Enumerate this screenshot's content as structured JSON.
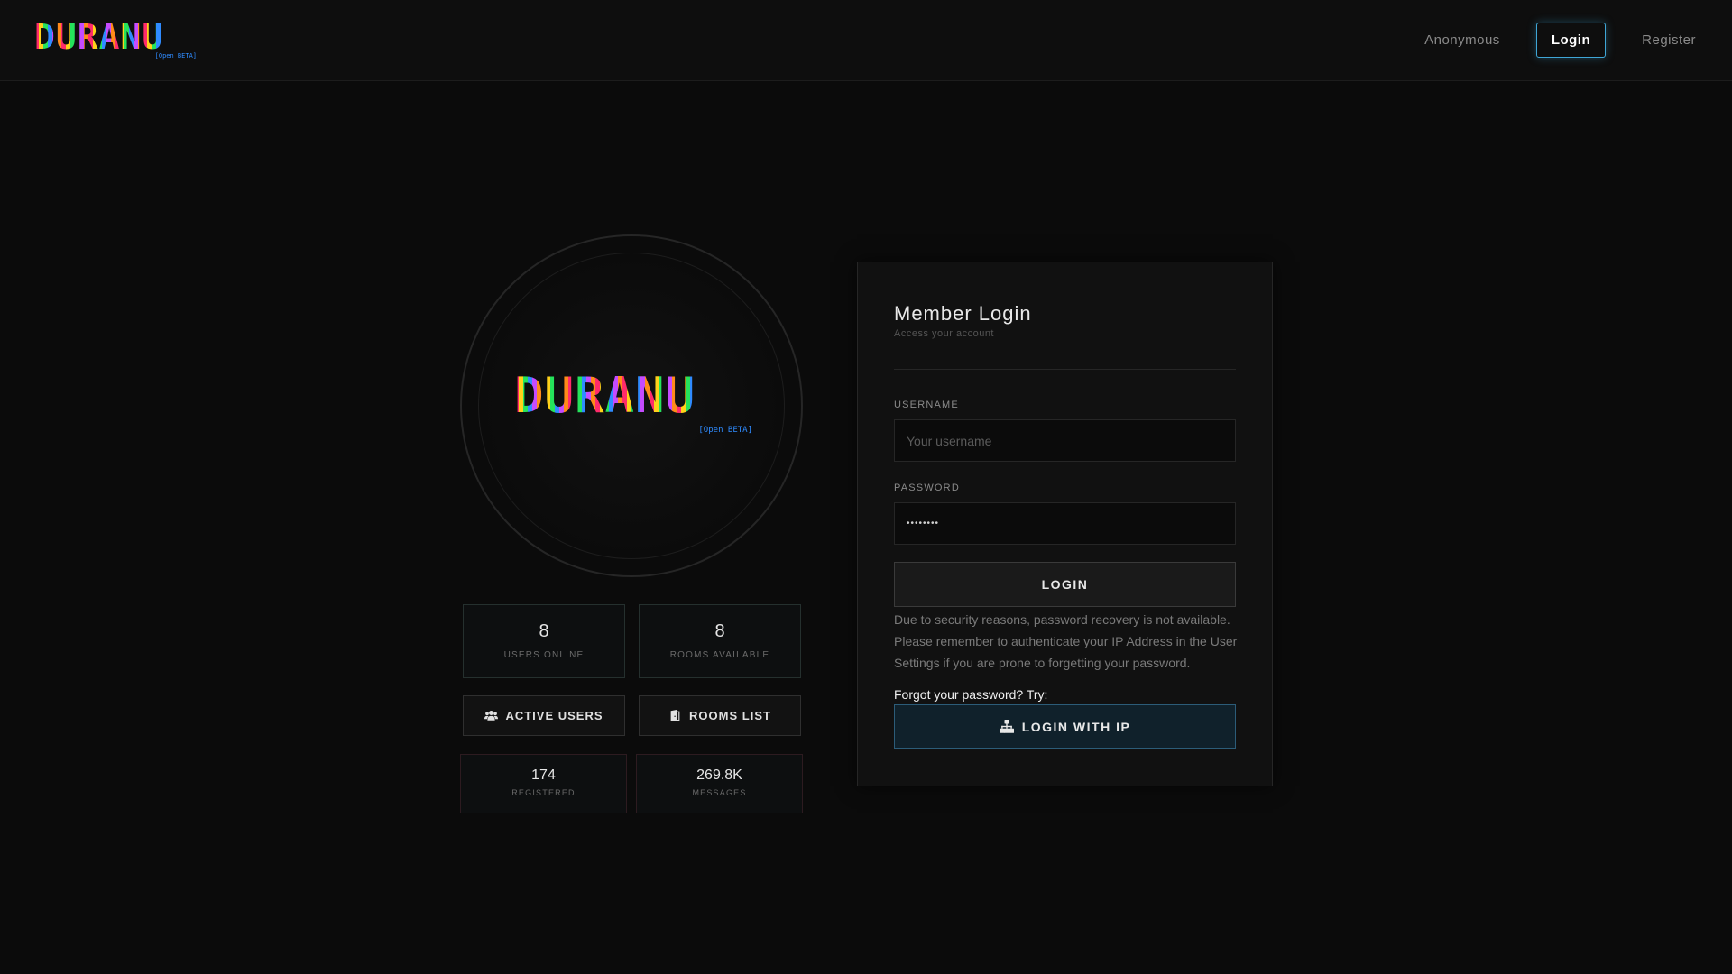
{
  "header": {
    "brand_name": "DURANU",
    "brand_tag": "[Open BETA]",
    "nav": {
      "anonymous": "Anonymous",
      "login": "Login",
      "register": "Register"
    }
  },
  "hero": {
    "logo_name": "DURANU",
    "logo_tag": "[Open BETA]"
  },
  "stats": {
    "users_online": {
      "value": "8",
      "label": "USERS ONLINE"
    },
    "rooms_available": {
      "value": "8",
      "label": "ROOMS AVAILABLE"
    },
    "registered": {
      "value": "174",
      "label": "REGISTERED"
    },
    "messages": {
      "value": "269.8K",
      "label": "MESSAGES"
    }
  },
  "actions": {
    "active_users": {
      "label": "ACTIVE USERS",
      "icon": "users-icon"
    },
    "rooms_list": {
      "label": "ROOMS LIST",
      "icon": "door-icon"
    }
  },
  "login_card": {
    "title": "Member Login",
    "subtitle": "Access your account",
    "username_label": "USERNAME",
    "username_placeholder": "Your username",
    "password_label": "PASSWORD",
    "password_value": "••••••••",
    "login_button": "LOGIN",
    "notice": "Due to security reasons, password recovery is not available. Please remember to authenticate your IP Address in the User Settings if you are prone to forgetting your password.",
    "forgot_text": "Forgot your password? Try:",
    "ip_button": {
      "label": "LOGIN WITH IP",
      "icon": "network-icon"
    }
  },
  "colors": {
    "background": "#0b0b0b",
    "accent_blue": "#3fa6d6",
    "ip_button_bg": "#10212b"
  }
}
